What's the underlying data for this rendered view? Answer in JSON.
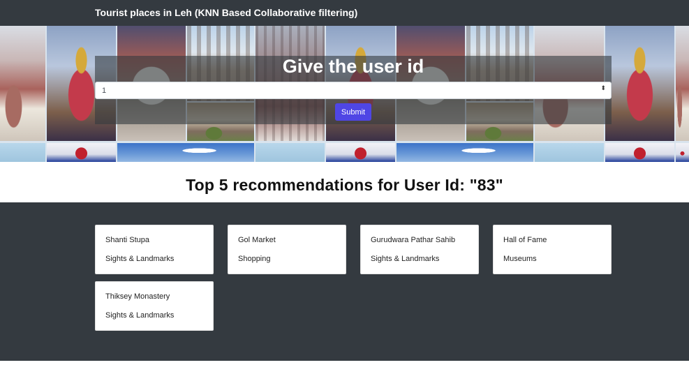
{
  "navbar": {
    "brand": "Tourist places in Leh (KNN Based Collaborative filtering)"
  },
  "hero": {
    "title": "Give the user id",
    "select_value": "1",
    "select_arrow": "⬍",
    "submit_label": "Submit"
  },
  "recommendations": {
    "heading": "Top 5 recommendations for User Id: \"83\"",
    "items": [
      {
        "name": "Shanti Stupa",
        "category": "Sights & Landmarks"
      },
      {
        "name": "Gol Market",
        "category": "Shopping"
      },
      {
        "name": "Gurudwara Pathar Sahib",
        "category": "Sights & Landmarks"
      },
      {
        "name": "Hall of Fame",
        "category": "Museums"
      },
      {
        "name": "Thiksey Monastery",
        "category": "Sights & Landmarks"
      }
    ]
  },
  "colors": {
    "navbar_bg": "#343a40",
    "section_bg": "#343a40",
    "submit_bg": "#4f46e5"
  }
}
